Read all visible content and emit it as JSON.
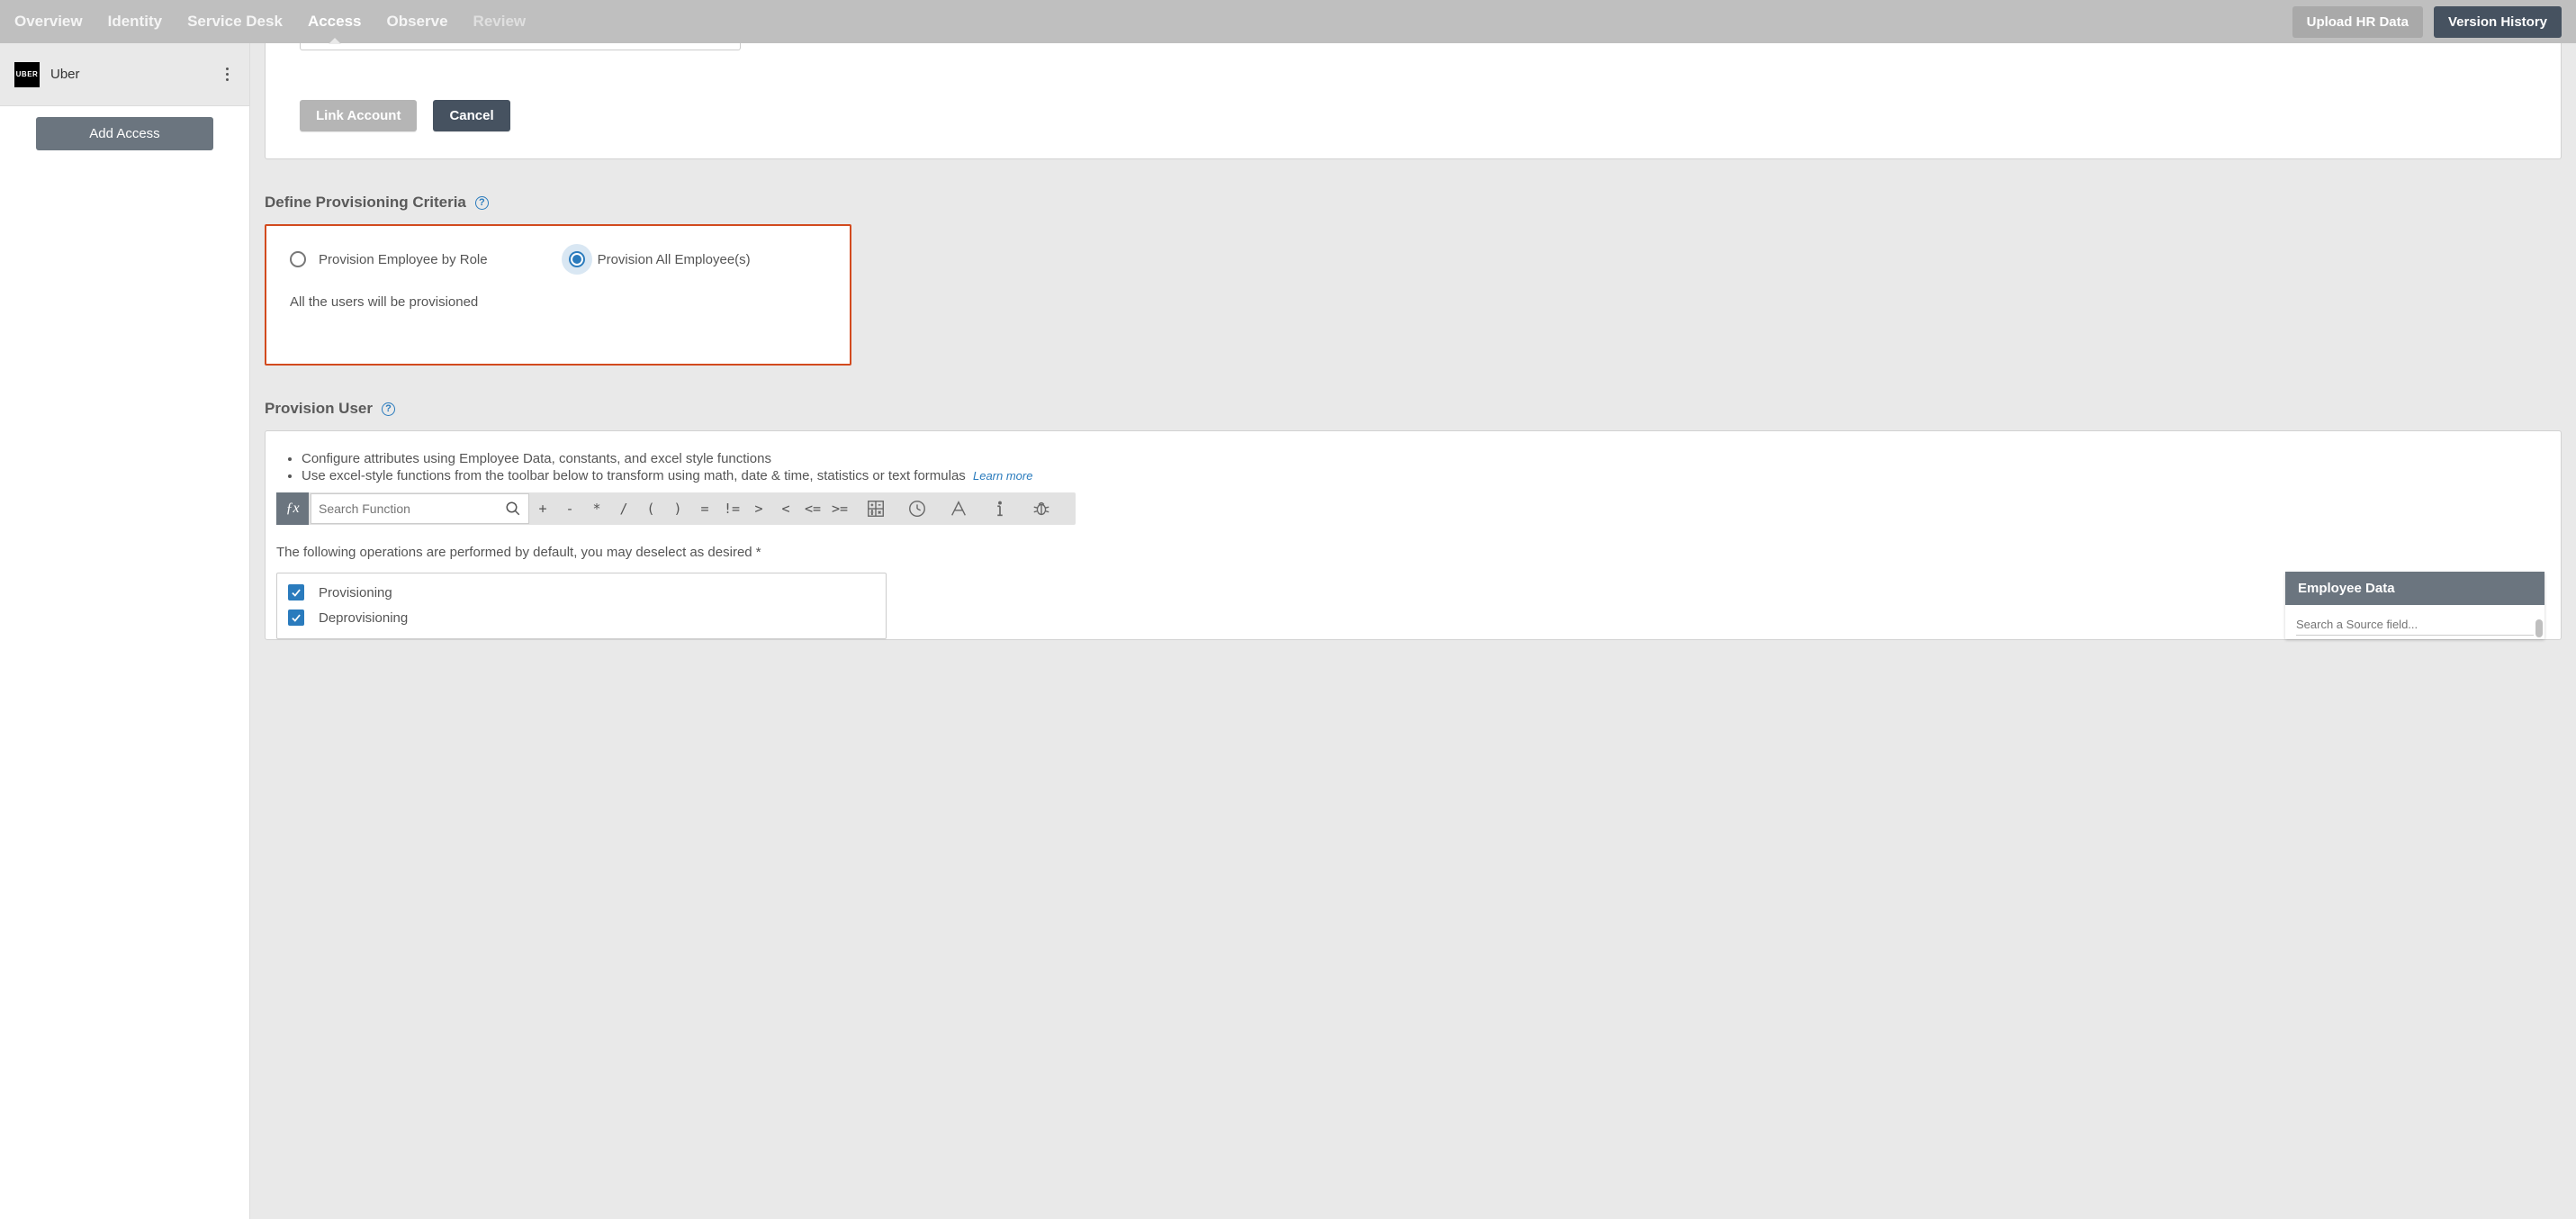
{
  "nav": {
    "tabs": [
      "Overview",
      "Identity",
      "Service Desk",
      "Access",
      "Observe",
      "Review"
    ],
    "active": "Access",
    "upload_btn": "Upload HR Data",
    "version_btn": "Version History"
  },
  "sidebar": {
    "org_logo_text": "UBER",
    "org_name": "Uber",
    "add_access_btn": "Add Access"
  },
  "link_section": {
    "link_btn": "Link Account",
    "cancel_btn": "Cancel"
  },
  "prov_criteria": {
    "title": "Define Provisioning Criteria",
    "opt_by_role": "Provision Employee by Role",
    "opt_all": "Provision All Employee(s)",
    "desc": "All the users will be provisioned"
  },
  "prov_user": {
    "title": "Provision User",
    "bullet1": "Configure attributes using Employee Data, constants, and excel style functions",
    "bullet2": "Use excel-style functions from the toolbar below to transform using math, date & time, statistics or text formulas",
    "learn_more": "Learn more",
    "fx_label": "ƒx",
    "search_placeholder": "Search Function",
    "ops": [
      "+",
      "-",
      "*",
      "/",
      "(",
      ")",
      "=",
      "!=",
      ">",
      "<",
      "<=",
      ">="
    ],
    "ops_intro": "The following operations are performed by default, you may deselect as desired *",
    "checks": [
      "Provisioning",
      "Deprovisioning"
    ]
  },
  "emp_panel": {
    "title": "Employee Data",
    "search_placeholder": "Search a Source field..."
  }
}
